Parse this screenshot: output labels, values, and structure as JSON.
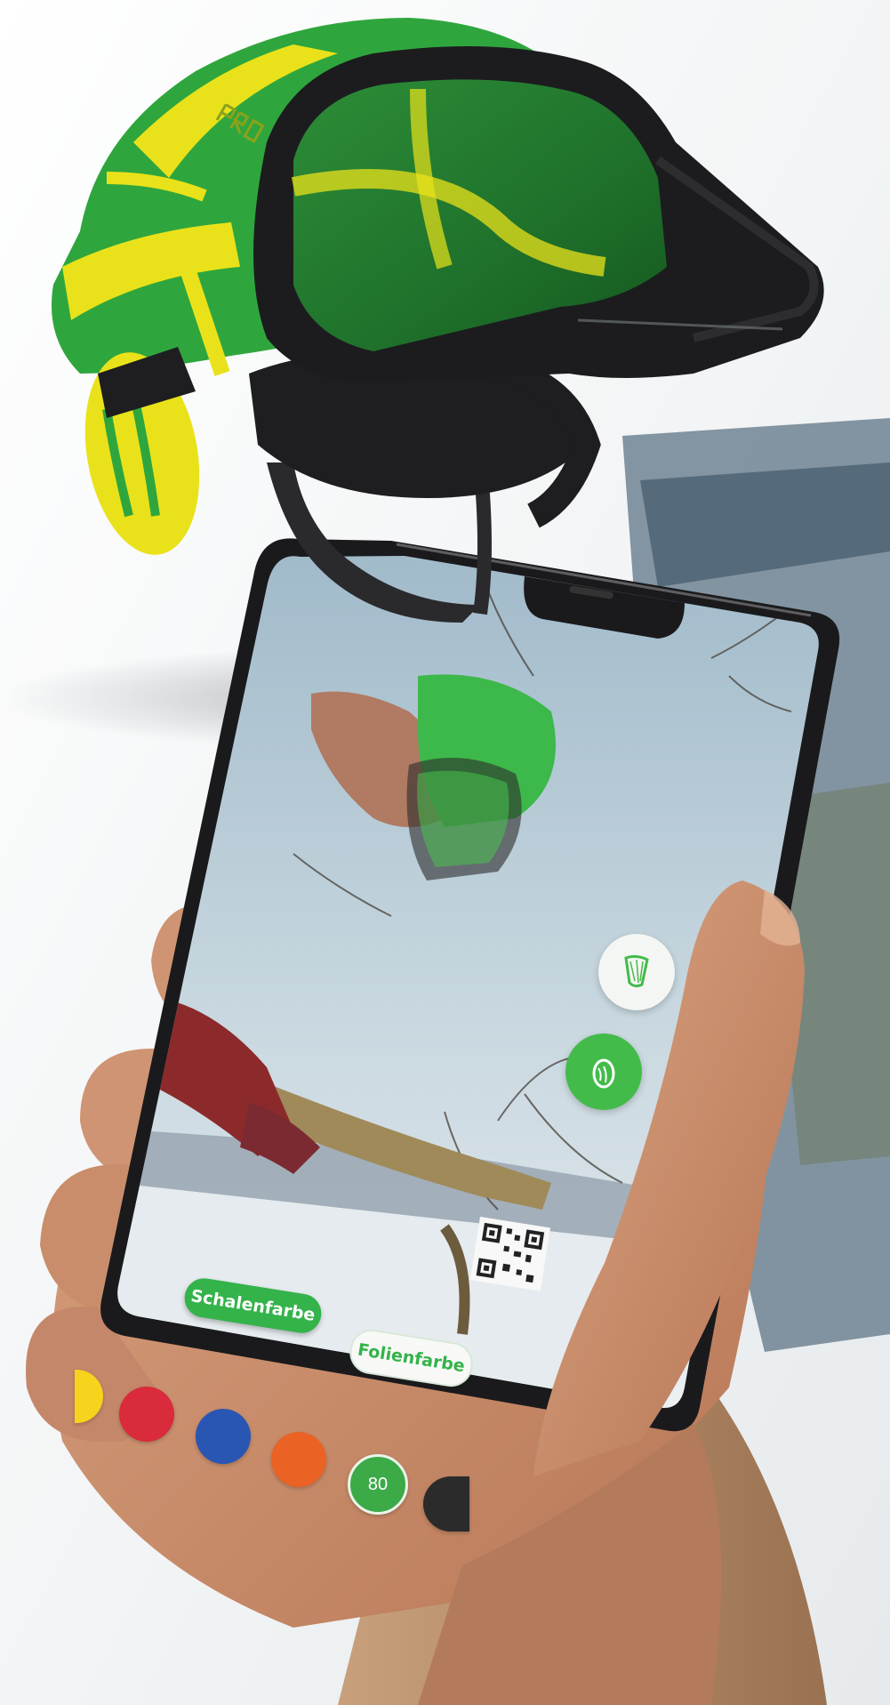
{
  "ar_app": {
    "tabs": [
      {
        "label": "Schalenfarbe",
        "active": true
      },
      {
        "label": "Folienfarbe",
        "active": false
      }
    ],
    "side_buttons": [
      {
        "icon": "visor-icon",
        "background": "#f4f6f4"
      },
      {
        "icon": "earmuff-icon",
        "background": "#43bb4a"
      }
    ],
    "color_swatches": [
      {
        "name": "yellow",
        "color": "#f6d31c"
      },
      {
        "name": "red",
        "color": "#d92b3c"
      },
      {
        "name": "blue",
        "color": "#2a56b3"
      },
      {
        "name": "orange",
        "color": "#ea6224"
      },
      {
        "name": "green",
        "color": "#3cab47",
        "selected": true,
        "label": "80"
      },
      {
        "name": "black",
        "color": "#2b2b2b"
      }
    ]
  },
  "colors": {
    "accent_green": "#34b34a",
    "helmet_green": "#2fa63d",
    "helmet_yellow": "#e9e21a"
  }
}
